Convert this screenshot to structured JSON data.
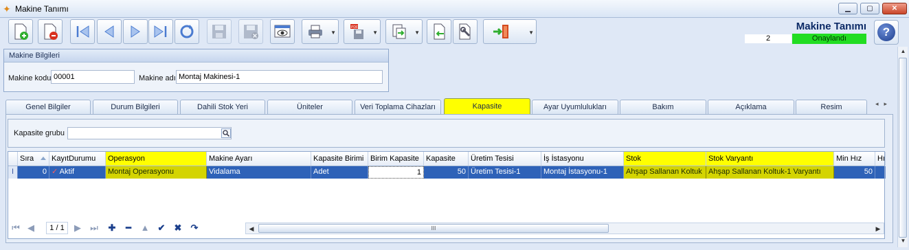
{
  "window": {
    "title": "Makine Tanımı",
    "icon": "butterfly-icon"
  },
  "toolbar": {
    "buttons": [
      "new-document-icon",
      "delete-document-icon",
      "first-record-icon",
      "previous-record-icon",
      "next-record-icon",
      "last-record-icon",
      "refresh-icon",
      "save-icon",
      "save-cancel-icon",
      "preview-icon",
      "print-icon",
      "pdf-export-icon",
      "export-icon",
      "import-icon",
      "tools-icon",
      "exit-icon"
    ]
  },
  "header": {
    "title": "Makine Tanımı",
    "count": "2",
    "status": "Onaylandı"
  },
  "machine_info": {
    "group_title": "Makine Bilgileri",
    "code_label": "Makine kodu",
    "code_value": "00001",
    "name_label": "Makine adı",
    "name_value": "Montaj Makinesi-1"
  },
  "tabs": [
    "Genel Bilgiler",
    "Durum Bilgileri",
    "Dahili Stok Yeri",
    "Üniteler",
    "Veri Toplama Cihazları",
    "Kapasite",
    "Ayar Uyumlulukları",
    "Bakım",
    "Açıklama",
    "Resim"
  ],
  "active_tab": "Kapasite",
  "capacity": {
    "group_label": "Kapasite grubu",
    "group_value": ""
  },
  "grid": {
    "columns": [
      "Sıra",
      "KayıtDurumu",
      "Operasyon",
      "Makine Ayarı",
      "Kapasite Birimi",
      "Birim Kapasite",
      "Kapasite",
      "Üretim Tesisi",
      "İş İstasyonu",
      "Stok",
      "Stok Varyantı",
      "Min Hız",
      "Hız"
    ],
    "highlighted_columns": [
      "Operasyon",
      "Stok",
      "Stok Varyantı"
    ],
    "rows": [
      {
        "indicator": "I",
        "sira": "0",
        "kayit_durumu": "Aktif",
        "operasyon": "Montaj Operasyonu",
        "makine_ayari": "Vidalama",
        "kapasite_birimi": "Adet",
        "birim_kapasite": "1",
        "kapasite": "50",
        "uretim_tesisi": "Üretim Tesisi-1",
        "is_istasyonu": "Montaj İstasyonu-1",
        "stok": "Ahşap Sallanan Koltuk",
        "stok_varyanti": "Ahşap Sallanan Koltuk-1 Varyantı",
        "min_hiz": "50"
      }
    ]
  },
  "navigator": {
    "page_indicator": "1 / 1",
    "scroll_thumb_label": "III"
  },
  "colors": {
    "highlight_yellow": "#ffff00",
    "selected_row": "#2e62b8",
    "status_green": "#22dd22"
  }
}
